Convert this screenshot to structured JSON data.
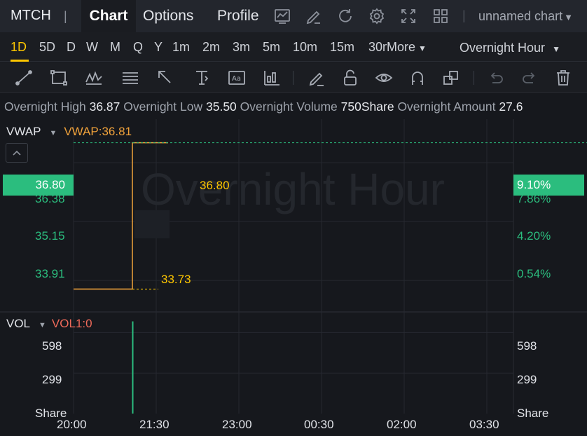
{
  "header": {
    "symbol": "MTCH",
    "tabs": [
      {
        "label": "Chart",
        "active": true
      },
      {
        "label": "Options",
        "active": false
      },
      {
        "label": "Profile",
        "active": false
      }
    ],
    "icons": [
      "indicator-chart-icon",
      "draw-pen-icon",
      "refresh-icon",
      "settings-gear-icon",
      "fullscreen-expand-icon",
      "layout-grid-icon"
    ],
    "chart_name": "unnamed chart"
  },
  "timeframes": {
    "items": [
      "1D",
      "5D",
      "D",
      "W",
      "M",
      "Q",
      "Y",
      "1m",
      "2m",
      "3m",
      "5m",
      "10m",
      "15m",
      "30m"
    ],
    "active": "1D",
    "more_label": "More",
    "session": "Overnight Hour"
  },
  "drawing_tools": [
    "trend-line-icon",
    "rectangle-icon",
    "pattern-icon",
    "fibonacci-icon",
    "arrow-icon",
    "measure-icon",
    "text-annotation-icon",
    "bar-pattern-icon",
    "pen-icon",
    "unlock-icon",
    "visibility-eye-icon",
    "magnet-icon",
    "clone-icon",
    "undo-icon",
    "redo-icon",
    "delete-trash-icon"
  ],
  "info": {
    "high_label": "Overnight High",
    "high_value": "36.87",
    "low_label": "Overnight Low",
    "low_value": "35.50",
    "volume_label": "Overnight Volume",
    "volume_value": "750Share",
    "amount_label": "Overnight Amount",
    "amount_value": "27.6"
  },
  "price_pane": {
    "indicator": "VWAP",
    "indicator_value": "VWAP:36.81",
    "watermark": "Overnight Hour",
    "current_price": "36.80",
    "current_pct": "9.10%",
    "left_ticks": [
      "36.38",
      "35.15",
      "33.91"
    ],
    "right_ticks": [
      "7.86%",
      "4.20%",
      "0.54%"
    ],
    "label_high": "36.80",
    "label_low": "33.73"
  },
  "volume_pane": {
    "indicator": "VOL",
    "indicator_value": "VOL1:0",
    "left_ticks": [
      "598",
      "299",
      "Share"
    ],
    "right_ticks": [
      "598",
      "299",
      "Share"
    ]
  },
  "time_axis": [
    "20:00",
    "21:30",
    "23:00",
    "00:30",
    "02:00",
    "03:30"
  ],
  "colors": {
    "accent": "#ffc700",
    "up": "#2bbd7e",
    "vwap": "#f0a23b",
    "vol_label": "#f06a5a"
  },
  "chart_data": {
    "type": "line",
    "x": [
      "20:00",
      "21:00",
      "21:00",
      "22:00"
    ],
    "y": [
      33.73,
      33.73,
      36.8,
      36.8
    ],
    "volume": {
      "x": [
        "21:00"
      ],
      "values": [
        680
      ]
    },
    "price_ylim": [
      33.25,
      37.25
    ],
    "volume_ylim": [
      0,
      750
    ]
  }
}
